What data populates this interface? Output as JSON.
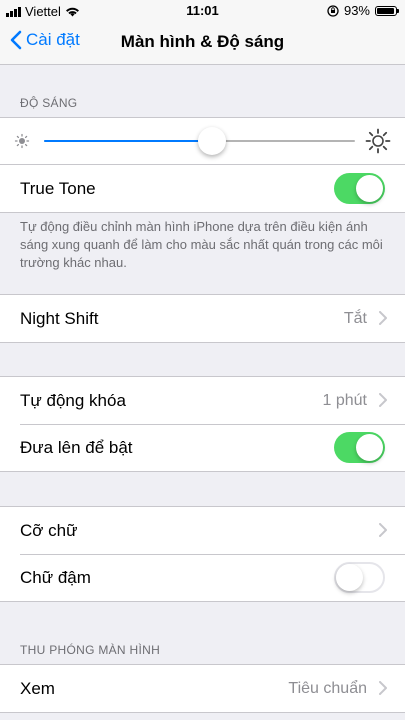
{
  "status_bar": {
    "carrier": "Viettel",
    "time": "11:01",
    "battery": "93%",
    "battery_level": 0.93
  },
  "nav": {
    "back_label": "Cài đặt",
    "title": "Màn hình & Độ sáng"
  },
  "brightness": {
    "header": "ĐỘ SÁNG",
    "level": 0.54,
    "true_tone_label": "True Tone",
    "true_tone_on": true,
    "footnote": "Tự động điều chỉnh màn hình iPhone dựa trên điều kiện ánh sáng xung quanh để làm cho màu sắc nhất quán trong các môi trường khác nhau."
  },
  "night_shift": {
    "label": "Night Shift",
    "value": "Tắt"
  },
  "lock": {
    "auto_lock_label": "Tự động khóa",
    "auto_lock_value": "1 phút",
    "raise_to_wake_label": "Đưa lên để bật",
    "raise_to_wake_on": true
  },
  "text": {
    "text_size_label": "Cỡ chữ",
    "bold_text_label": "Chữ đậm",
    "bold_text_on": false
  },
  "zoom": {
    "header": "THU PHÓNG MÀN HÌNH",
    "view_label": "Xem",
    "view_value": "Tiêu chuẩn"
  },
  "colors": {
    "accent": "#007aff",
    "toggle_on": "#4cd964"
  }
}
